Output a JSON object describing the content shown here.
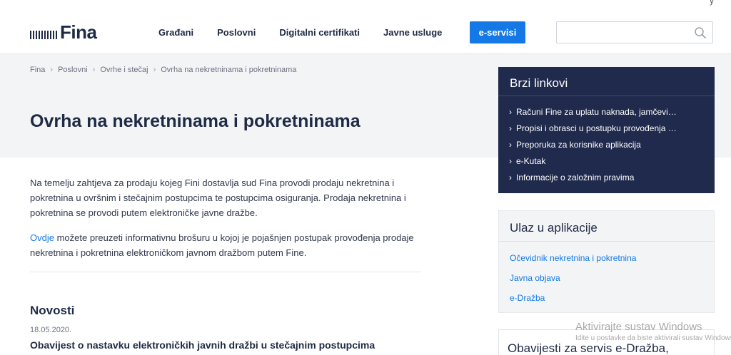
{
  "top_strip": {
    "fragment": "y"
  },
  "header": {
    "logo_text": "Fina",
    "nav": [
      "Građani",
      "Poslovni",
      "Digitalni certifikati",
      "Javne usluge"
    ],
    "eservisi_label": "e-servisi",
    "search": {
      "value": "",
      "placeholder": ""
    }
  },
  "breadcrumb": [
    "Fina",
    "Poslovni",
    "Ovrhe i stečaj",
    "Ovrha na nekretninama i pokretninama"
  ],
  "page_title": "Ovrha na nekretninama i pokretninama",
  "intro": {
    "paragraph1": "Na temelju zahtjeva za prodaju kojeg Fini dostavlja sud Fina provodi prodaju nekretnina i pokretnina u ovršnim i stečajnim postupcima te postupcima osiguranja. Prodaja nekretnina i pokretnina se provodi putem elektroničke javne dražbe.",
    "link_text": "Ovdje",
    "paragraph2_rest": " možete preuzeti informativnu brošuru u kojoj je pojašnjen postupak provođenja prodaje nekretnina i pokretnina elektroničkom javnom dražbom putem Fine."
  },
  "news": {
    "title": "Novosti",
    "date": "18.05.2020.",
    "headline": "Obavijest o nastavku elektroničkih javnih dražbi u stečajnim postupcima"
  },
  "quick_links": {
    "title": "Brzi linkovi",
    "items": [
      "Računi Fine za uplatu naknada, jamčevi…",
      "Propisi i obrasci u postupku provođenja …",
      "Preporuka za korisnike aplikacija",
      "e-Kutak",
      "Informacije o založnim pravima"
    ]
  },
  "apps": {
    "title": "Ulaz u aplikacije",
    "items": [
      "Očevidnik nekretnina i pokretnina",
      "Javna objava",
      "e-Dražba"
    ]
  },
  "notices": {
    "title": "Obavijesti za servis e-Dražba,"
  },
  "watermark": {
    "line1": "Aktivirajte sustav Windows",
    "line2": "Idite u postavke da biste aktivirali sustav Windows."
  },
  "colors": {
    "brand_dark": "#1f2a44",
    "accent": "#1479e6",
    "panel_dark": "#1f2a4c",
    "band": "#f3f4f6"
  }
}
